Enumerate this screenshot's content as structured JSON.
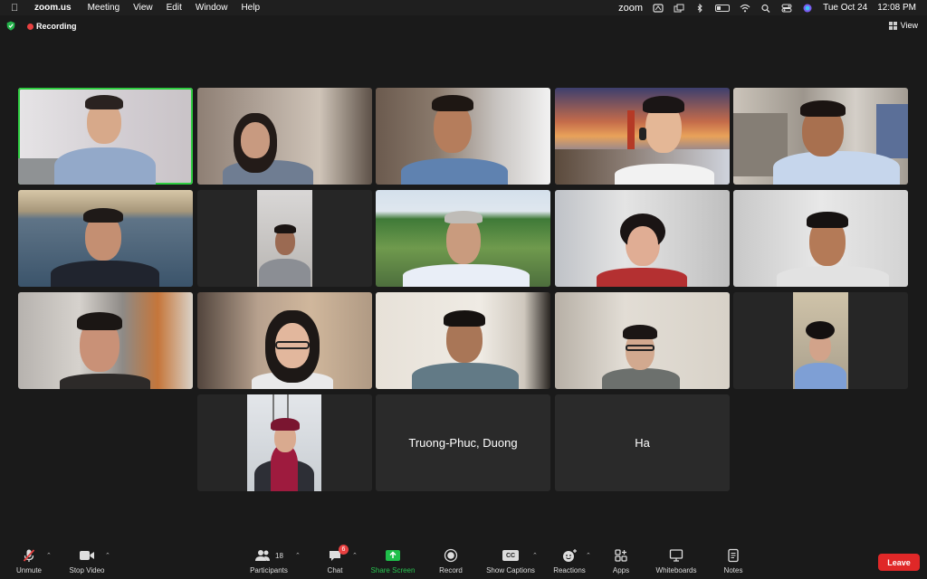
{
  "menubar": {
    "app": "zoom.us",
    "menus": [
      "Meeting",
      "View",
      "Edit",
      "Window",
      "Help"
    ],
    "status_app": "zoom",
    "date": "Tue Oct 24",
    "time": "12:08 PM"
  },
  "topbar": {
    "recording": "Recording",
    "view": "View"
  },
  "tiles": {
    "name_tile_1": "Truong-Phuc, Duong",
    "name_tile_2": "Ha"
  },
  "toolbar": {
    "unmute": "Unmute",
    "stop_video": "Stop Video",
    "participants": "Participants",
    "participants_count": "18",
    "chat": "Chat",
    "chat_badge": "6",
    "share_screen": "Share Screen",
    "record": "Record",
    "cc": "CC",
    "show_captions": "Show Captions",
    "reactions": "Reactions",
    "apps": "Apps",
    "whiteboards": "Whiteboards",
    "notes": "Notes",
    "leave": "Leave"
  },
  "colors": {
    "active_speaker": "#2ecc40",
    "share_green": "#1fbf4a",
    "leave_red": "#e02828",
    "recording_red": "#e84040"
  }
}
